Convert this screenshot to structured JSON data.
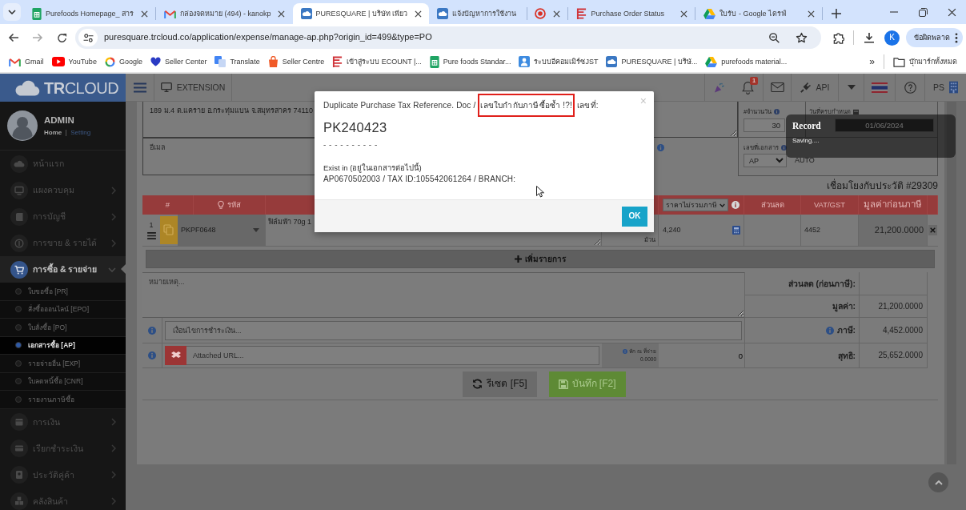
{
  "browser": {
    "tabs": [
      {
        "kind": "sheet",
        "title": "Purefoods Homepage_ สาร",
        "selected": false,
        "closable": true
      },
      {
        "kind": "mail",
        "title": "กล่องจดหมาย (494) - kanokp",
        "selected": false,
        "closable": true
      },
      {
        "kind": "cloud",
        "title": "PURESQUARE | บริษัท เพียว",
        "selected": true,
        "closable": true
      },
      {
        "kind": "cloud",
        "title": "แจ้งปัญหาการใช้งาน",
        "selected": false,
        "closable": false
      },
      {
        "kind": "record",
        "selected": false,
        "closable": true
      },
      {
        "kind": "bars",
        "title": "Purchase Order Status",
        "selected": false,
        "closable": true
      },
      {
        "kind": "drive",
        "title": "ใบรับ - Google ไดรฟ์",
        "selected": false,
        "closable": true
      }
    ],
    "address": "puresquare.trcloud.co/application/expense/manage-ap.php?origin_id=499&type=PO",
    "profile": "K",
    "error_button": "ข้อผิดพลาด",
    "bookmarks": [
      {
        "kind": "mail",
        "label": "Gmail"
      },
      {
        "kind": "video",
        "label": "YouTube"
      },
      {
        "kind": "ring",
        "label": "Google"
      },
      {
        "kind": "heart",
        "label": "Seller Center"
      },
      {
        "kind": "translate",
        "label": "Translate"
      },
      {
        "kind": "bag",
        "label": "Seller Centre"
      },
      {
        "kind": "bars",
        "label": "เข้าสู่ระบบ ECOUNT |..."
      },
      {
        "kind": "sheet",
        "label": "Pure foods Standar..."
      },
      {
        "kind": "person",
        "label": "ระบบอีคอมเมิร์ซJST"
      },
      {
        "kind": "cloud",
        "label": "PURESQUARE | บริษั..."
      },
      {
        "kind": "drive",
        "label": "purefoods material..."
      }
    ],
    "more_bookmarks": "»",
    "all_bookmarks": "บุ๊กมาร์กทั้งหมด"
  },
  "app": {
    "logo": "**TR**CLOUD",
    "topbar": {
      "extension": "EXTENSION",
      "notifications": "1",
      "api": "API",
      "user": "PS"
    },
    "sidebar": {
      "user": {
        "name": "ADMIN",
        "home": "Home",
        "setting": "Setting"
      },
      "items": [
        {
          "kind": "home",
          "label": "หน้าแรก",
          "selected": false
        },
        {
          "kind": "dashboard",
          "label": "แผงควบคุม",
          "selected": false,
          "expanded": false
        },
        {
          "kind": "accounting",
          "label": "การบัญชี",
          "selected": false,
          "expanded": false
        },
        {
          "kind": "sales",
          "label": "การขาย & รายได้",
          "selected": false,
          "expanded": false
        },
        {
          "kind": "purchase",
          "label": "การซื้อ & รายจ่าย",
          "selected": true,
          "expanded": true,
          "children": [
            {
              "label": "ใบขอซื้อ [PR]",
              "selected": false
            },
            {
              "label": "สั่งซื้อออนไลน์ [EPO]",
              "selected": false
            },
            {
              "label": "ใบสั่งซื้อ [PO]",
              "selected": false
            },
            {
              "label": "เอกสารซื้อ [AP]",
              "selected": true
            },
            {
              "label": "รายจ่ายอื่น [EXP]",
              "selected": false
            },
            {
              "label": "ใบลดหนี้ซื้อ [CNR]",
              "selected": false
            },
            {
              "label": "รายงานภาษีซื้อ",
              "selected": false
            }
          ]
        },
        {
          "kind": "finance",
          "label": "การเงิน",
          "selected": false,
          "expanded": false
        },
        {
          "kind": "billing",
          "label": "เรียกชำระเงิน",
          "selected": false,
          "expanded": false
        },
        {
          "kind": "partners",
          "label": "ประวัติคู่ค้า",
          "selected": false,
          "expanded": false
        },
        {
          "kind": "inventory",
          "label": "คลังสินค้า",
          "selected": false,
          "expanded": false
        }
      ]
    },
    "form": {
      "address": "189 ม.4 ต.แคราย อ.กระทุ่มแบน จ.สมุทรสาคร 74110",
      "email": {
        "placeholder": "อีเมล"
      },
      "credit_days": {
        "label": "#จำนวนวัน",
        "value": "30"
      },
      "due_date": {
        "label": "วันที่ครบกำหนด",
        "value": "01/06/2024"
      },
      "document_number": {
        "label": "เลขที่เอกสาร",
        "prefix": "AP",
        "value": "AUTO"
      },
      "history_link": "เชื่อมโยงกับประวัติ #29309",
      "table": {
        "columns": [
          {
            "kind": "plain",
            "label": "#"
          },
          {
            "kind": "code",
            "label": "รหัส"
          },
          {
            "kind": "select",
            "label": "ราคาไม่รวมภาษี"
          },
          {
            "kind": "plain",
            "label": "ส่วนลด"
          },
          {
            "kind": "plain",
            "label": "VAT/GST"
          },
          {
            "kind": "total",
            "label": "มูลค่าก่อนภาษี"
          }
        ],
        "rows": [
          {
            "number": "1",
            "code": "PKPF0648",
            "description": "ฟิล์มฟ้า 70g 1",
            "unit": "ม้วน",
            "price": "4,240",
            "vat": "4452",
            "amount": "21,200.0000"
          }
        ]
      },
      "add_row": "เพิ่มรายการ",
      "notes": {
        "placeholder": "หมายเหตุ..."
      },
      "payment_terms": {
        "placeholder": "เงื่อนไขการชำระเงิน..."
      },
      "attached_url": {
        "placeholder": "Attached URL..."
      },
      "withholding": {
        "label": "หัก ณ ที่จ่าย",
        "rate": "0.0000",
        "amount": "0"
      },
      "summary": [
        {
          "label": "ส่วนลด (ก่อนภาษี):",
          "info": false
        },
        {
          "label": "มูลค่า:",
          "value": "21,200.0000",
          "info": false
        },
        {
          "label": "ภาษี:",
          "value": "4,452.0000",
          "info": true
        },
        {
          "label": "สุทธิ:",
          "value": "25,652.0000",
          "info": false
        }
      ],
      "buttons": [
        {
          "kind": "reset",
          "label": "รีเซต [F5]"
        },
        {
          "kind": "save",
          "label": "บันทึก [F2]"
        }
      ]
    },
    "modal": {
      "message": "Duplicate Purchase Tax Reference. Doc /",
      "highlight": "เลขใบกำกับภาษีซื้อซ้ำ !?!",
      "message_end": "เลขที่:",
      "close": "×",
      "document": "PK240423",
      "separator": "- - - - - - - - - -",
      "exist_label": "Exist in (อยู่ในเอกสารต่อไปนี้)",
      "exist_detail": "AP0670502003 / TAX ID:105542061264 / BRANCH:",
      "ok": "OK"
    },
    "toast": {
      "title": "Record",
      "message": "Saving...."
    }
  }
}
